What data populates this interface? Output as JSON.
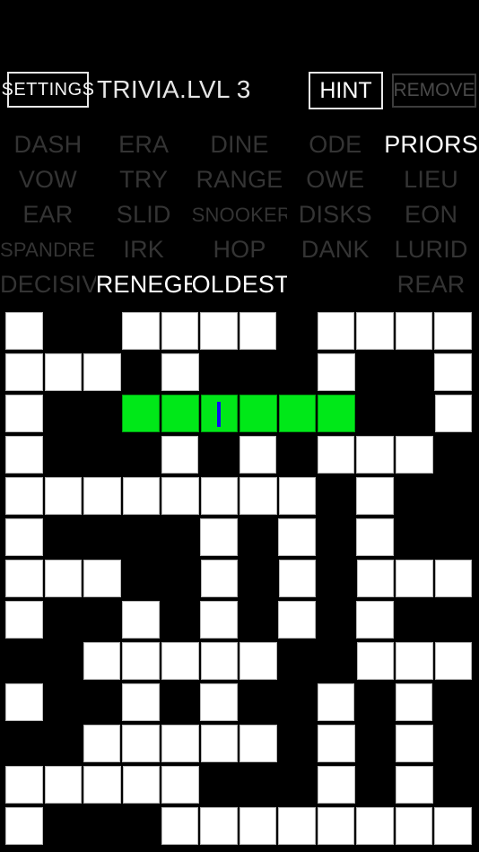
{
  "header": {
    "settings_label": "SETTINGS",
    "title": "TRIVIA.LVL 3",
    "hint_label": "HINT",
    "remove_label": "REMOVE"
  },
  "colors": {
    "background": "#000000",
    "cell_open": "#ffffff",
    "cell_active": "#00e818",
    "cursor": "#0d0df0",
    "word_dim": "#343434",
    "word_found": "#ffffff"
  },
  "wordlist": {
    "rows": [
      [
        {
          "text": "DASH",
          "found": false
        },
        {
          "text": "ERA",
          "found": false
        },
        {
          "text": "DINE",
          "found": false
        },
        {
          "text": "ODE",
          "found": false
        },
        {
          "text": "PRIORS",
          "found": true
        }
      ],
      [
        {
          "text": "VOW",
          "found": false
        },
        {
          "text": "TRY",
          "found": false
        },
        {
          "text": "RANGE",
          "found": false
        },
        {
          "text": "OWE",
          "found": false
        },
        {
          "text": "LIEU",
          "found": false
        }
      ],
      [
        {
          "text": "EAR",
          "found": false
        },
        {
          "text": "SLID",
          "found": false
        },
        {
          "text": "SNOOKERS",
          "found": false,
          "long": true
        },
        {
          "text": "DISKS",
          "found": false
        },
        {
          "text": "EON",
          "found": false
        }
      ],
      [
        {
          "text": "SPANDREL",
          "found": false,
          "long": true
        },
        {
          "text": "IRK",
          "found": false
        },
        {
          "text": "HOP",
          "found": false
        },
        {
          "text": "DANK",
          "found": false
        },
        {
          "text": "LURID",
          "found": false
        }
      ],
      [
        {
          "text": "DECISIVE",
          "found": false
        },
        {
          "text": "RENEGE",
          "found": true
        },
        {
          "text": "OLDEST",
          "found": true
        },
        {
          "text": "",
          "found": false
        },
        {
          "text": "REAR",
          "found": false
        }
      ]
    ]
  },
  "grid": {
    "columns": 12,
    "rows": 13,
    "cursor": {
      "row": 2,
      "col": 5
    },
    "cells": [
      [
        "open",
        "block",
        "block",
        "open",
        "open",
        "open",
        "open",
        "block",
        "open",
        "open",
        "open",
        "open"
      ],
      [
        "open",
        "open",
        "open",
        "block",
        "open",
        "block",
        "block",
        "block",
        "open",
        "block",
        "block",
        "open"
      ],
      [
        "open",
        "block",
        "block",
        "active",
        "active",
        "active",
        "active",
        "active",
        "active",
        "block",
        "block",
        "open"
      ],
      [
        "open",
        "block",
        "block",
        "block",
        "open",
        "block",
        "open",
        "block",
        "open",
        "open",
        "open",
        "block"
      ],
      [
        "open",
        "open",
        "open",
        "open",
        "open",
        "open",
        "open",
        "open",
        "block",
        "open",
        "block",
        "block"
      ],
      [
        "open",
        "block",
        "block",
        "block",
        "block",
        "open",
        "block",
        "open",
        "block",
        "open",
        "block",
        "block"
      ],
      [
        "open",
        "open",
        "open",
        "block",
        "block",
        "open",
        "block",
        "open",
        "block",
        "open",
        "open",
        "open"
      ],
      [
        "open",
        "block",
        "block",
        "open",
        "block",
        "open",
        "block",
        "open",
        "block",
        "open",
        "block",
        "block"
      ],
      [
        "block",
        "block",
        "open",
        "open",
        "open",
        "open",
        "open",
        "block",
        "block",
        "open",
        "open",
        "open"
      ],
      [
        "open",
        "block",
        "block",
        "open",
        "block",
        "open",
        "block",
        "block",
        "open",
        "block",
        "open",
        "block"
      ],
      [
        "block",
        "block",
        "open",
        "open",
        "open",
        "open",
        "open",
        "block",
        "open",
        "block",
        "open",
        "block"
      ],
      [
        "open",
        "open",
        "open",
        "open",
        "open",
        "block",
        "block",
        "block",
        "open",
        "block",
        "open",
        "block"
      ],
      [
        "open",
        "block",
        "block",
        "block",
        "open",
        "open",
        "open",
        "open",
        "open",
        "open",
        "open",
        "open"
      ]
    ]
  }
}
